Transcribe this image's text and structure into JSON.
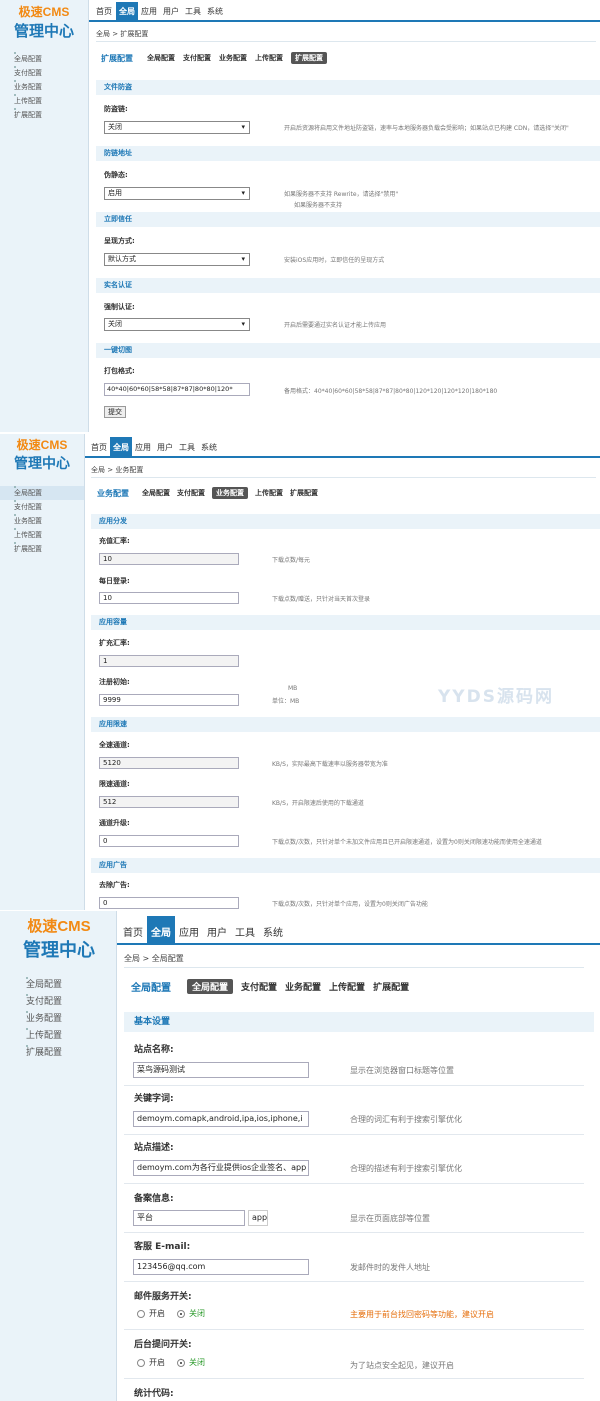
{
  "logo": {
    "line1": "极速CMS",
    "line2": "管理中心"
  },
  "nav": {
    "items": [
      "首页",
      "全局",
      "应用",
      "用户",
      "工具",
      "系统"
    ],
    "active": "全局"
  },
  "side_menu": [
    "全局配置",
    "支付配置",
    "业务配置",
    "上传配置",
    "扩展配置"
  ],
  "watermark": "YYDS源码网",
  "screen1": {
    "breadcrumb": "全局 > 扩展配置",
    "tabs_title": "扩展配置",
    "tabs": [
      "全局配置",
      "支付配置",
      "业务配置",
      "上传配置",
      "扩展配置"
    ],
    "active_tab": "扩展配置",
    "sections": [
      {
        "title": "文件防盗",
        "label": "防盗链:",
        "value": "关闭",
        "hint": "开启后资源将启用文件地址防盗链，速率与本地服务器负载会受影响；如果站点已构建 CDN，请选择\"关闭\""
      },
      {
        "title": "防链地址",
        "label": "伪静态:",
        "value": "启用",
        "hint": "如果服务器不支持 Rewrite，请选择\"禁用\"",
        "hint2": "如果服务器不支持"
      },
      {
        "title": "立即信任",
        "label": "呈现方式:",
        "value": "默认方式",
        "hint": "安装iOS应用时，立即信任的呈现方式"
      },
      {
        "title": "实名认证",
        "label": "强制认证:",
        "value": "关闭",
        "hint": "开启后需要通过实名认证才能上传应用"
      },
      {
        "title": "一键切图",
        "label": "打包格式:",
        "value": "40*40|60*60|58*58|87*87|80*80|120*",
        "hint": "备用格式：40*40|60*60|58*58|87*87|80*80|120*120|120*120|180*180"
      }
    ],
    "submit": "提交"
  },
  "screen2": {
    "breadcrumb": "全局 > 业务配置",
    "tabs_title": "业务配置",
    "tabs": [
      "全局配置",
      "支付配置",
      "业务配置",
      "上传配置",
      "扩展配置"
    ],
    "active_tab": "业务配置",
    "groups": [
      {
        "title": "应用分发",
        "fields": [
          {
            "label": "充值汇率:",
            "value": "10",
            "hint": "下载点数/每元"
          },
          {
            "label": "每日登录:",
            "value": "10",
            "hint": "下载点数/赠送，只针对当天首次登录"
          }
        ]
      },
      {
        "title": "应用容量",
        "fields": [
          {
            "label": "扩充汇率:",
            "value": "1",
            "hint": "MB"
          },
          {
            "label": "注册初始:",
            "value": "9999",
            "hint": "单位：MB"
          }
        ]
      },
      {
        "title": "应用限速",
        "fields": [
          {
            "label": "全速通道:",
            "value": "5120",
            "hint": "KB/S，实际最高下载速率以服务器带宽为准"
          },
          {
            "label": "限速通道:",
            "value": "512",
            "hint": "KB/S，开启限速后使用的下载通道"
          },
          {
            "label": "通道升级:",
            "value": "0",
            "hint": "下载点数/次数，只针对单个未加文件应用且已开启限速通道，设置为0则关闭限速功能而使用全速通道"
          }
        ]
      },
      {
        "title": "应用广告",
        "fields": [
          {
            "label": "去除广告:",
            "value": "0",
            "hint": "下载点数/次数，只针对单个应用，设置为0则关闭广告功能"
          }
        ]
      }
    ]
  },
  "screen3": {
    "breadcrumb": "全局 > 全局配置",
    "tabs_title": "全局配置",
    "tabs": [
      "全局配置",
      "支付配置",
      "业务配置",
      "上传配置",
      "扩展配置"
    ],
    "active_tab": "全局配置",
    "section_title": "基本设置",
    "fields": [
      {
        "label": "站点名称:",
        "value": "菜鸟源码测试",
        "hint": "显示在浏览器窗口标题等位置"
      },
      {
        "label": "关键字词:",
        "value": "demoym.comapk,android,ipa,ios,iphone,i",
        "hint": "合理的词汇有利于搜索引擎优化"
      },
      {
        "label": "站点描述:",
        "value": "demoym.com为各行业提供ios企业签名、app",
        "hint": "合理的描述有利于搜索引擎优化"
      },
      {
        "label": "备案信息:",
        "value": "平台",
        "value2": "app",
        "hint": "显示在页面底部等位置"
      },
      {
        "label": "客服 E-mail:",
        "value": "123456@qq.com",
        "hint": "发邮件时的发件人地址"
      }
    ],
    "radios": [
      {
        "label": "邮件服务开关:",
        "on": "开启",
        "off": "关闭",
        "selected": "关闭",
        "hint": "主要用于前台找回密码等功能，建议开启"
      },
      {
        "label": "后台提问开关:",
        "on": "开启",
        "off": "关闭",
        "selected": "关闭",
        "hint": "为了站点安全起见，建议开启"
      }
    ],
    "last_label": "统计代码:"
  }
}
